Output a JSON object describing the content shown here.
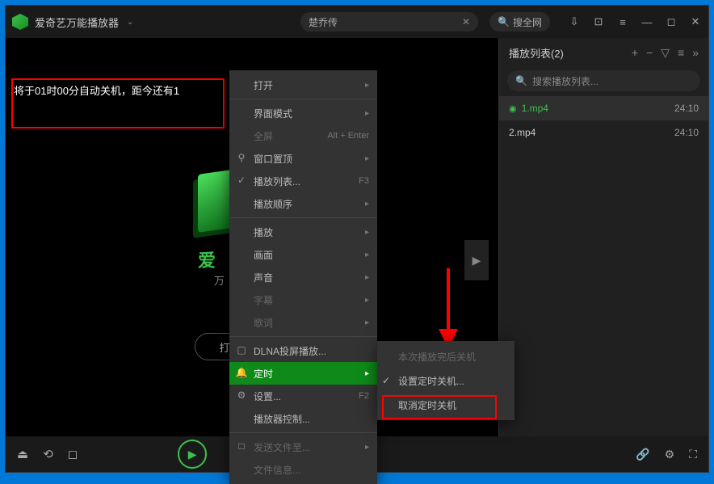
{
  "titlebar": {
    "app_name": "爱奇艺万能播放器",
    "search_value": "楚乔传",
    "search_web": "搜全网"
  },
  "notice": "将于01时00分自动关机，距今还有1",
  "brand": {
    "name": "爱",
    "sub": "万"
  },
  "open_label": "打开…",
  "playlist": {
    "title": "播放列表(2)",
    "search_placeholder": "搜索播放列表...",
    "items": [
      {
        "name": "1.mp4",
        "duration": "24:10",
        "active": true
      },
      {
        "name": "2.mp4",
        "duration": "24:10",
        "active": false
      }
    ]
  },
  "menu": {
    "open": "打开",
    "ui_mode": "界面模式",
    "fullscreen": "全屏",
    "fullscreen_sc": "Alt + Enter",
    "ontop": "窗口置顶",
    "playlist": "播放列表...",
    "playlist_sc": "F3",
    "order": "播放顺序",
    "play": "播放",
    "frame": "画面",
    "audio": "声音",
    "sub": "字幕",
    "lyric": "歌词",
    "dlna": "DLNA投屏播放...",
    "timer": "定时",
    "settings": "设置...",
    "settings_sc": "F2",
    "control": "播放器控制...",
    "send": "发送文件至...",
    "info": "文件信息..."
  },
  "submenu": {
    "after": "本次播放完后关机",
    "set": "设置定时关机...",
    "cancel": "取消定时关机"
  }
}
